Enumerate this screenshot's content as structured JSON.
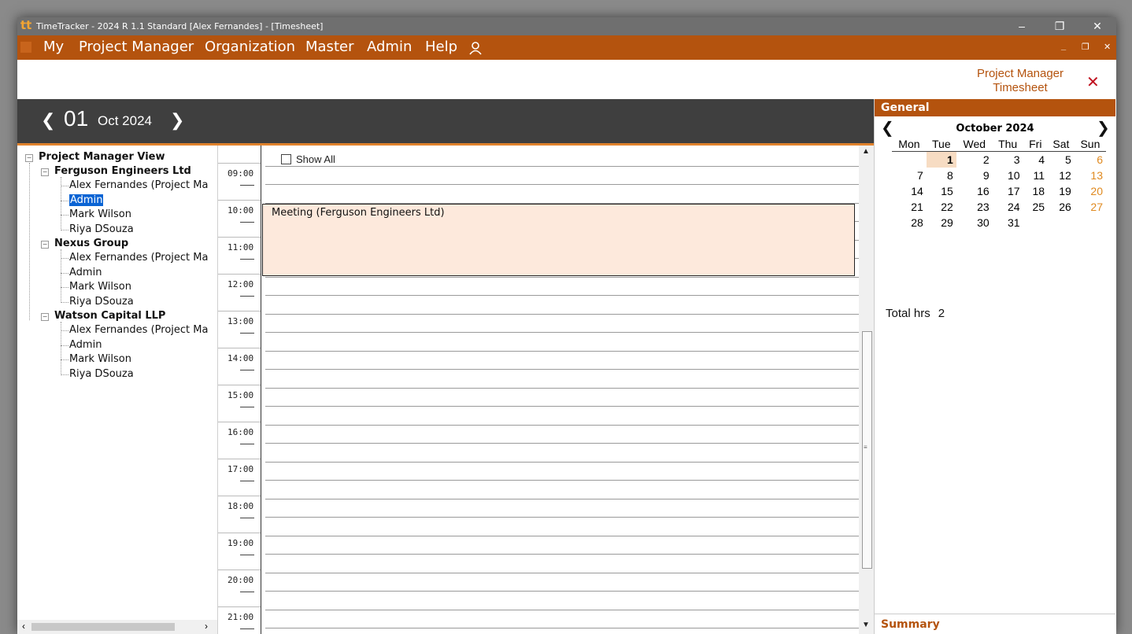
{
  "window": {
    "title": "TimeTracker - 2024 R 1.1 Standard [Alex Fernandes] - [Timesheet]",
    "logo": "tt"
  },
  "menu": {
    "items": [
      "My",
      "Project Manager",
      "Organization",
      "Master",
      "Admin",
      "Help"
    ]
  },
  "header": {
    "breadcrumb_line1": "Project Manager",
    "breadcrumb_line2": "Timesheet"
  },
  "datebar": {
    "day": "01",
    "month_year": "Oct 2024"
  },
  "tree": {
    "root": "Project Manager View",
    "groups": [
      {
        "name": "Ferguson Engineers Ltd",
        "members": [
          "Alex Fernandes (Project Ma",
          "Admin",
          "Mark Wilson",
          "Riya DSouza"
        ]
      },
      {
        "name": "Nexus Group",
        "members": [
          "Alex Fernandes (Project Ma",
          "Admin",
          "Mark Wilson",
          "Riya DSouza"
        ]
      },
      {
        "name": "Watson Capital LLP",
        "members": [
          "Alex Fernandes (Project Ma",
          "Admin",
          "Mark Wilson",
          "Riya DSouza"
        ]
      }
    ],
    "selected": "Ferguson Engineers Ltd / Admin"
  },
  "schedule": {
    "show_all_label": "Show All",
    "show_all_checked": false,
    "hours": [
      "09:00",
      "10:00",
      "11:00",
      "12:00",
      "13:00",
      "14:00",
      "15:00",
      "16:00",
      "17:00",
      "18:00",
      "19:00",
      "20:00",
      "21:00"
    ],
    "appointment": {
      "label": "Meeting (Ferguson Engineers Ltd)",
      "start": "10:00",
      "end": "12:00"
    }
  },
  "right_panel": {
    "section_title": "General",
    "calendar": {
      "title": "October 2024",
      "weekdays": [
        "Mon",
        "Tue",
        "Wed",
        "Thu",
        "Fri",
        "Sat",
        "Sun"
      ],
      "weeks": [
        [
          "",
          "1",
          "2",
          "3",
          "4",
          "5",
          "6"
        ],
        [
          "7",
          "8",
          "9",
          "10",
          "11",
          "12",
          "13"
        ],
        [
          "14",
          "15",
          "16",
          "17",
          "18",
          "19",
          "20"
        ],
        [
          "21",
          "22",
          "23",
          "24",
          "25",
          "26",
          "27"
        ],
        [
          "28",
          "29",
          "30",
          "31",
          "",
          "",
          ""
        ]
      ],
      "selected_day": "1"
    },
    "total_label": "Total hrs",
    "total_value": "2",
    "summary_title": "Summary"
  },
  "colors": {
    "menu_bg": "#b4530e",
    "accent": "#e0822c",
    "appointment_bg": "#fde9dc",
    "selection": "#0a64d4",
    "weekend": "#e08a20"
  }
}
